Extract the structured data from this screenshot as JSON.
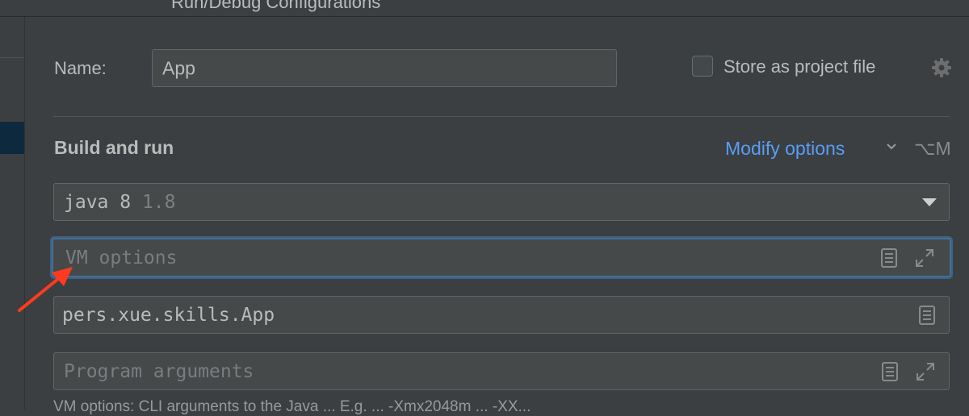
{
  "window": {
    "title": "Run/Debug Configurations"
  },
  "name_row": {
    "label": "Name:",
    "value": "App",
    "store_label": "Store as project file"
  },
  "build_run": {
    "heading": "Build and run",
    "modify_options": "Modify options",
    "shortcut": "⌥M",
    "jdk": {
      "name": "java 8",
      "version": "1.8"
    },
    "vm_options": {
      "placeholder": "VM options"
    },
    "main_class": {
      "value": "pers.xue.skills.App"
    },
    "program_args": {
      "placeholder": "Program arguments"
    }
  },
  "colors": {
    "accent": "#589df6",
    "focus": "#466d94",
    "annotation": "#ff3b1f"
  },
  "footer": {
    "text": "VM options: CLI arguments to the Java ... E.g. ... -Xmx2048m ... -XX..."
  }
}
